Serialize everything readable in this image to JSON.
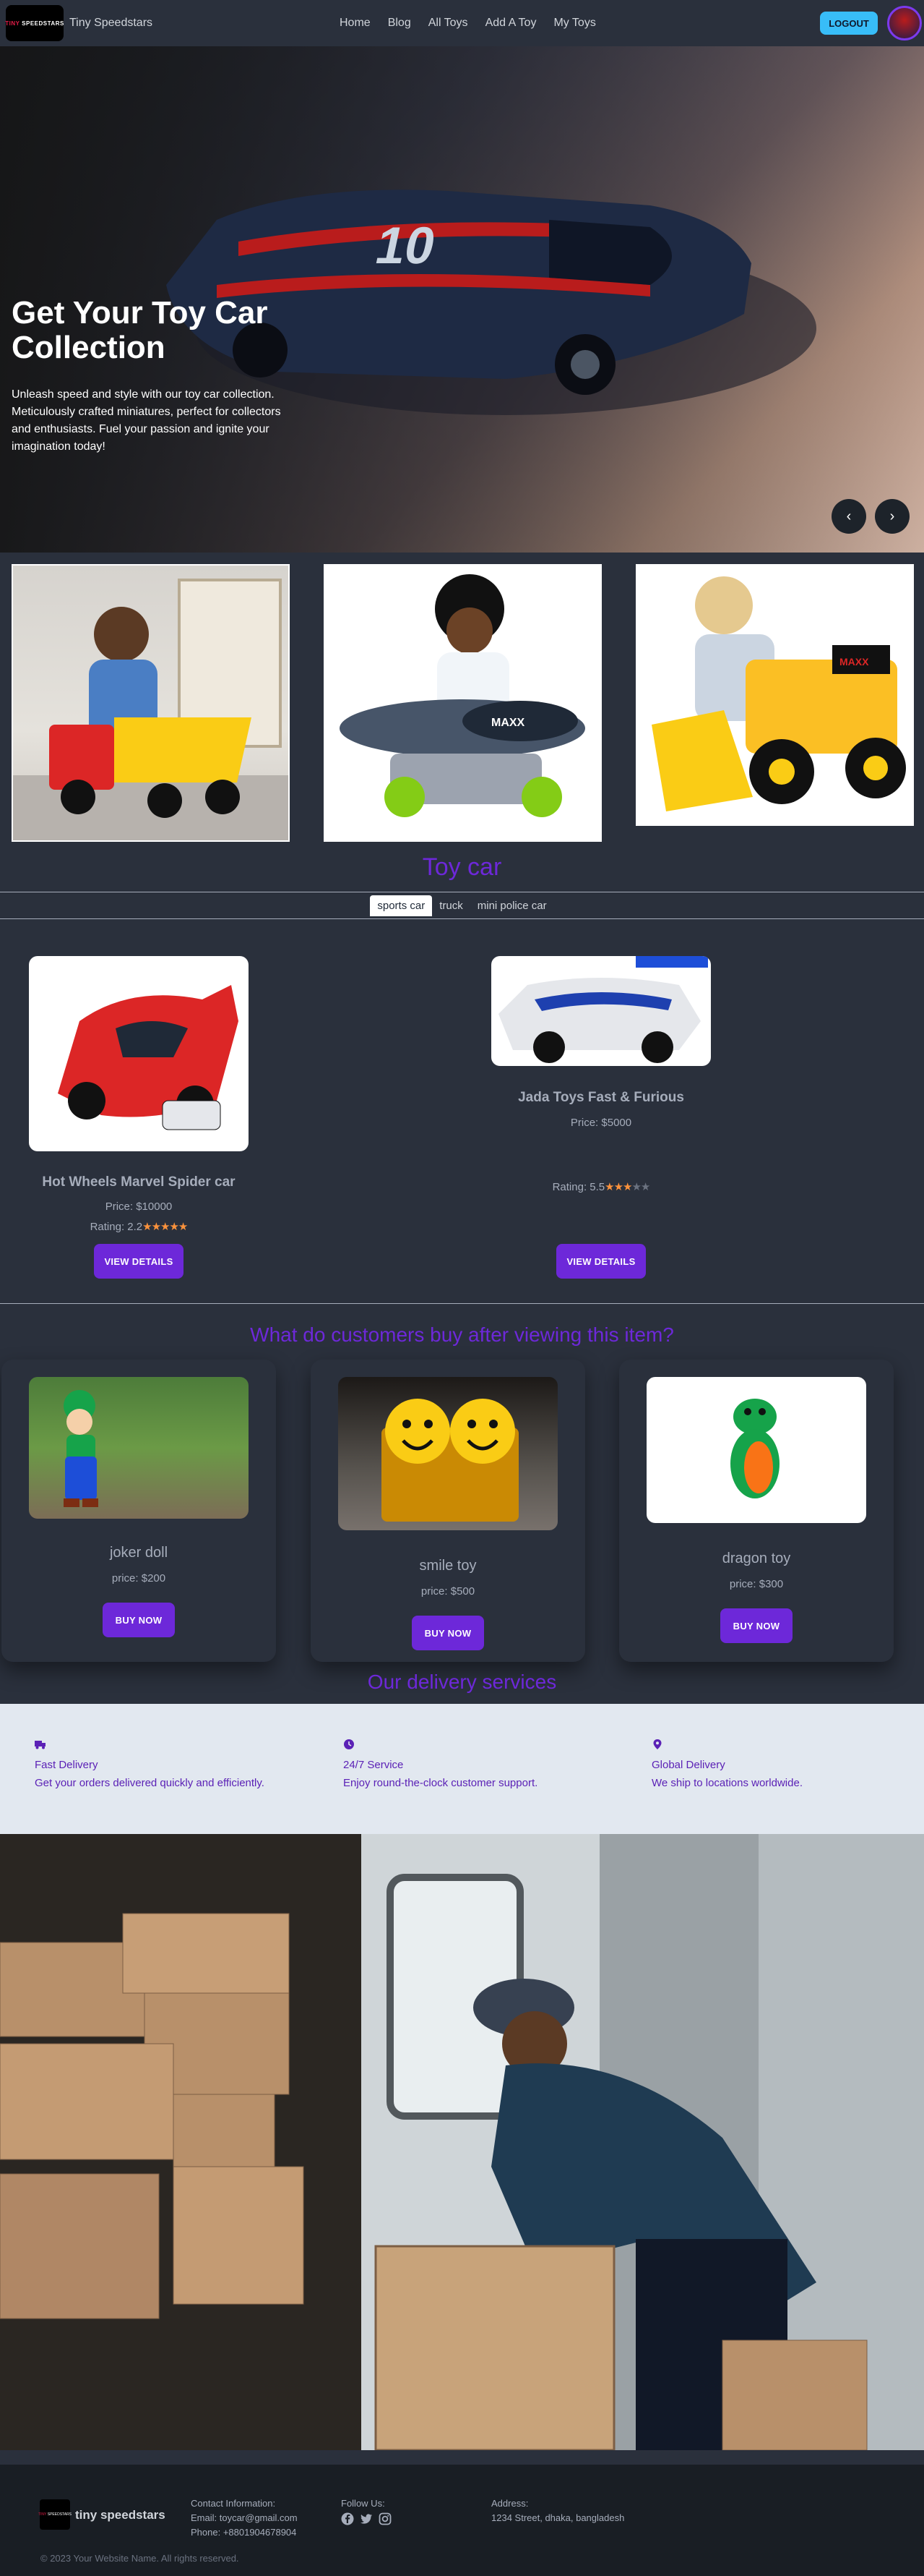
{
  "nav": {
    "logo_text_red": "TINY",
    "logo_text_white": "SPEEDSTARS",
    "brand": "Tiny Speedstars",
    "links": [
      "Home",
      "Blog",
      "All Toys",
      "Add A Toy",
      "My Toys"
    ],
    "logout": "LOGOUT"
  },
  "hero": {
    "title": "Get Your Toy Car Collection",
    "text": "Unleash speed and style with our toy car collection. Meticulously crafted miniatures, perfect for collectors and enthusiasts. Fuel your passion and ignite your imagination today!",
    "prev": "‹",
    "next": "›",
    "car_number": "10"
  },
  "gallery_toy_labels": [
    "MAXX",
    "MAXX"
  ],
  "toy_section": {
    "title": "Toy car",
    "tabs": [
      "sports car",
      "truck",
      "mini police car"
    ],
    "active_tab": 0,
    "cards": [
      {
        "name": "Hot Wheels Marvel Spider car",
        "price": "Price: $10000",
        "rating": "Rating: 2.2",
        "stars_filled": 5,
        "stars_total": 5,
        "button": "VIEW DETAILS"
      },
      {
        "name": "Jada Toys Fast & Furious",
        "price": "Price: $5000",
        "rating": "Rating: 5.5",
        "stars_filled": 3,
        "stars_total": 5,
        "button": "VIEW DETAILS"
      }
    ]
  },
  "customers": {
    "title": "What do customers buy after viewing this item?",
    "items": [
      {
        "name": "joker doll",
        "price": "price: $200",
        "button": "BUY NOW"
      },
      {
        "name": "smile toy",
        "price": "price: $500",
        "button": "BUY NOW"
      },
      {
        "name": "dragon toy",
        "price": "price: $300",
        "button": "BUY NOW"
      }
    ]
  },
  "delivery": {
    "title": "Our delivery services",
    "services": [
      {
        "icon": "truck-icon",
        "title": "Fast Delivery",
        "desc": "Get your orders delivered quickly and efficiently."
      },
      {
        "icon": "clock-icon",
        "title": "24/7 Service",
        "desc": "Enjoy round-the-clock customer support."
      },
      {
        "icon": "location-pin-icon",
        "title": "Global Delivery",
        "desc": "We ship to locations worldwide."
      }
    ]
  },
  "footer": {
    "brand": "tiny speedstars",
    "contact_title": "Contact Information:",
    "email": "Email: toycar@gmail.com",
    "phone": "Phone: +8801904678904",
    "follow_title": "Follow Us:",
    "address_title": "Address:",
    "address": "1234 Street, dhaka, bangladesh",
    "copyright": "© 2023 Your Website Name. All rights reserved."
  },
  "colors": {
    "background": "#2a303c",
    "accent_purple": "#6d28d9",
    "logout_blue": "#38bdf8",
    "star_orange": "#fb923c",
    "footer": "#191e24"
  }
}
